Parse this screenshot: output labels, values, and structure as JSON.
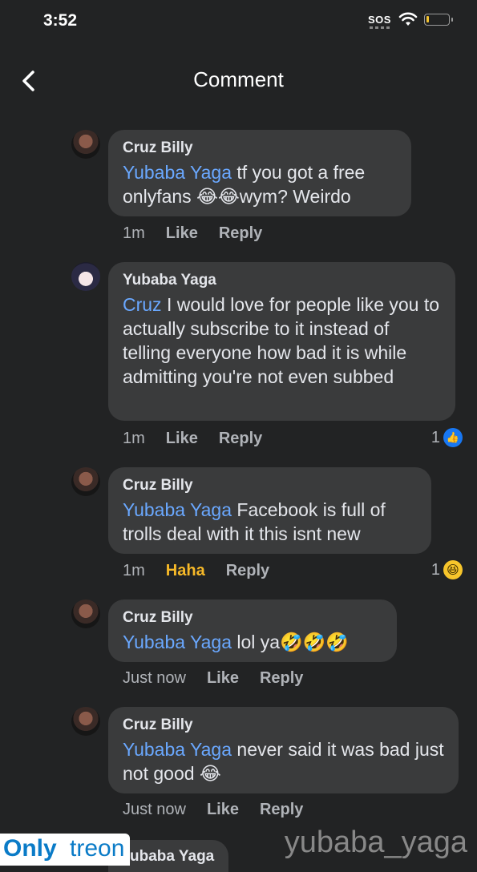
{
  "status_bar": {
    "time": "3:52",
    "sos": "SOS"
  },
  "header": {
    "title": "Comment"
  },
  "comments": [
    {
      "author": "Cruz Billy",
      "mention": "Yubaba Yaga",
      "text": " tf you got a free onlyfans 😂😂wym? Weirdo",
      "time": "1m",
      "like": "Like",
      "reply": "Reply"
    },
    {
      "author": "Yubaba Yaga",
      "mention": "Cruz",
      "text": " I would love for people like you to actually subscribe to it instead of telling everyone how bad it is while admitting you're not even subbed",
      "time": "1m",
      "like": "Like",
      "reply": "Reply",
      "reaction_count": "1"
    },
    {
      "author": "Cruz Billy",
      "mention": "Yubaba Yaga",
      "text": " Facebook is full of trolls deal with it this isnt new",
      "time": "1m",
      "like": "Haha",
      "reply": "Reply",
      "reaction_count": "1"
    },
    {
      "author": "Cruz Billy",
      "mention": "Yubaba Yaga",
      "text": " lol ya🤣🤣🤣",
      "time": "Just now",
      "like": "Like",
      "reply": "Reply"
    },
    {
      "author": "Cruz Billy",
      "mention": "Yubaba Yaga",
      "text": " never said it was bad just not good 😂",
      "time": "Just now",
      "like": "Like",
      "reply": "Reply"
    }
  ],
  "partial_author": "ubaba Yaga",
  "watermark": {
    "left_part1": "Only",
    "left_part2": "treon",
    "right": "yubaba_yaga"
  },
  "colors": {
    "background": "#222324",
    "bubble": "#3a3b3c",
    "mention": "#6aa8ff",
    "haha": "#f7b928",
    "like_blue": "#1877f2"
  }
}
